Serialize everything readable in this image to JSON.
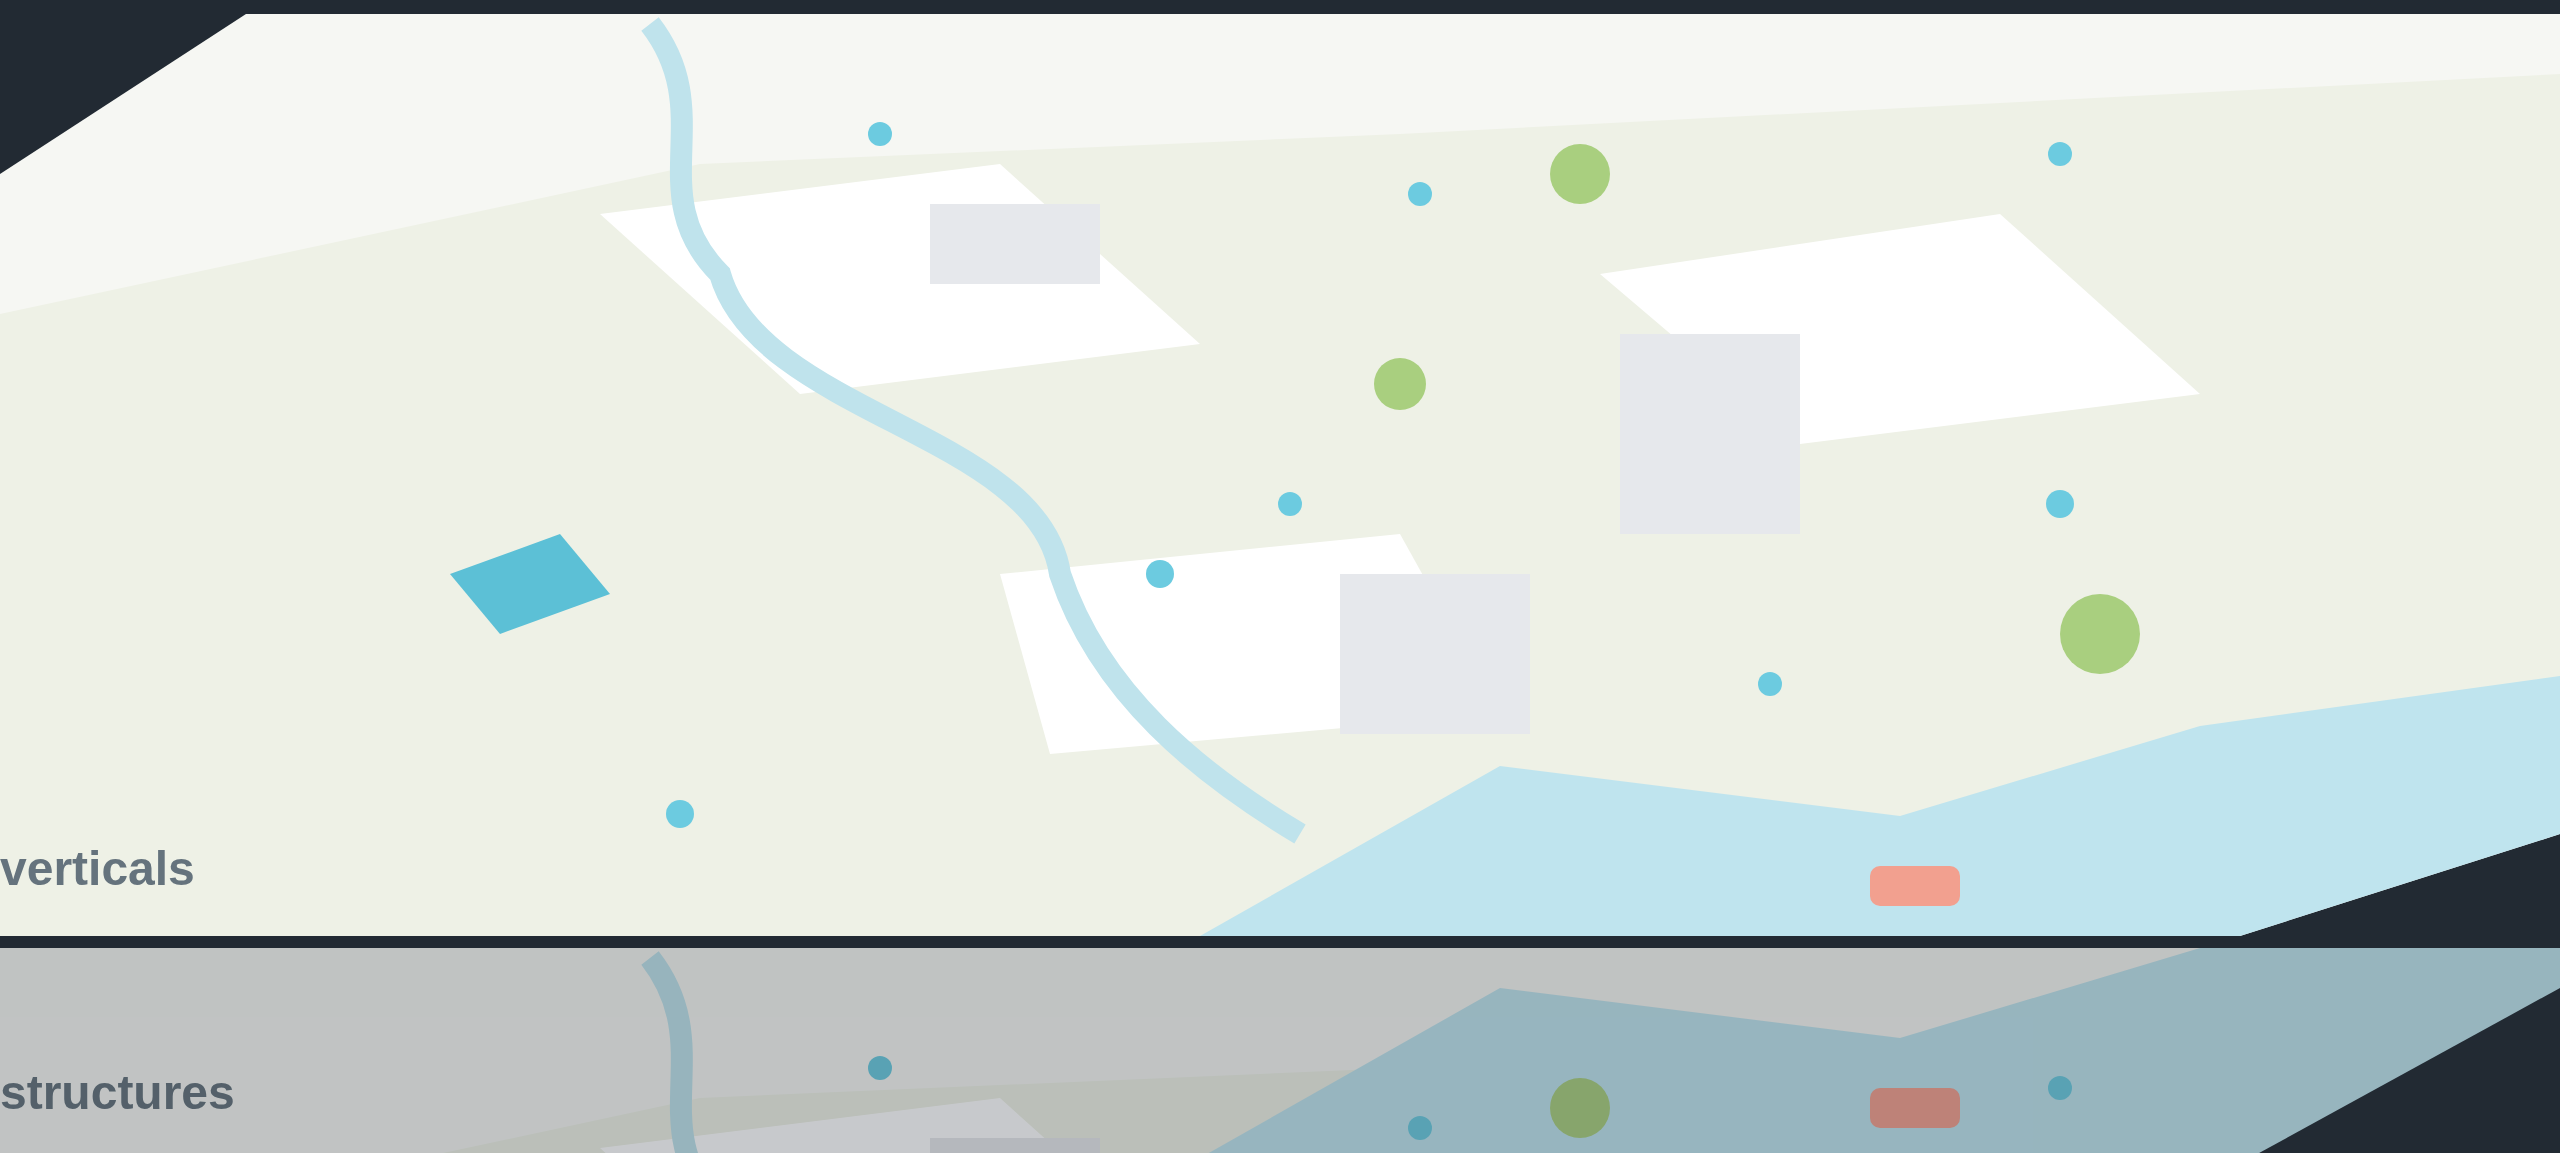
{
  "panels": [
    {
      "caption": "verticals"
    },
    {
      "caption": "structures"
    }
  ]
}
